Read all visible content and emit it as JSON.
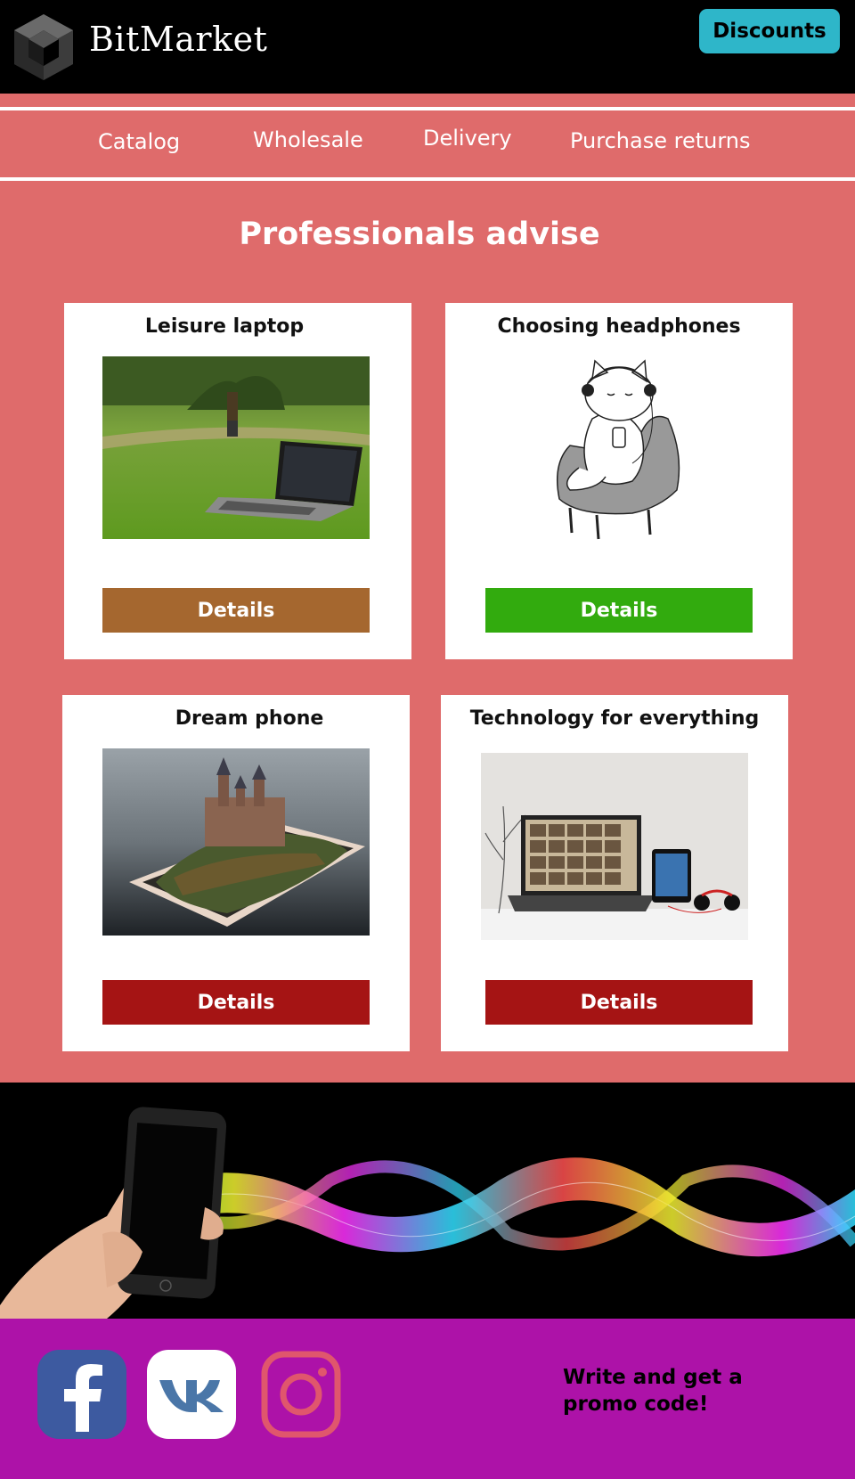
{
  "header": {
    "logo_text": "BitMarket",
    "discounts_label": "Discounts"
  },
  "nav": {
    "items": [
      {
        "label": "Catalog"
      },
      {
        "label": "Wholesale"
      },
      {
        "label": "Delivery"
      },
      {
        "label": "Purchase returns"
      }
    ]
  },
  "main": {
    "title": "Professionals advise",
    "cards": [
      {
        "title": "Leisure laptop",
        "button": "Details",
        "button_color": "#a5672f"
      },
      {
        "title": "Choosing headphones",
        "button": "Details",
        "button_color": "#32ab0e"
      },
      {
        "title": "Dream phone",
        "button": "Details",
        "button_color": "#a51414"
      },
      {
        "title": "Technology for everything",
        "button": "Details",
        "button_color": "#a51414"
      }
    ]
  },
  "footer": {
    "social": [
      {
        "icon": "facebook-icon"
      },
      {
        "icon": "vk-icon"
      },
      {
        "icon": "instagram-icon"
      }
    ],
    "promo_text": "Write and get a promo code!"
  },
  "colors": {
    "header_bg": "#000000",
    "main_bg": "#df6b6b",
    "discounts_bg": "#2eb6c9",
    "footer_bg": "#ad12a8"
  }
}
